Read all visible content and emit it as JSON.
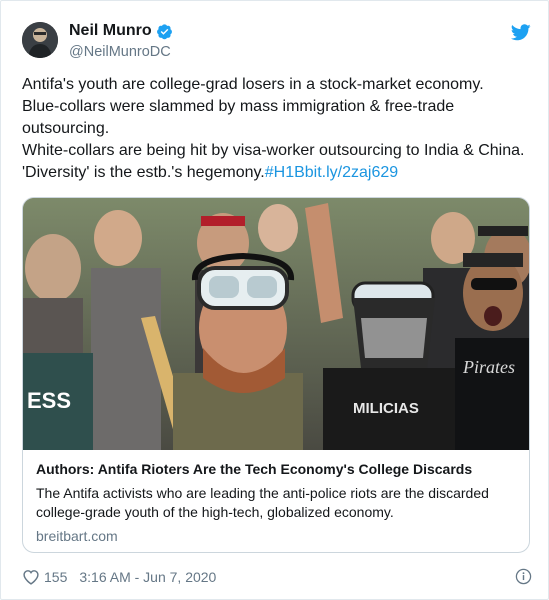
{
  "author": {
    "display_name": "Neil Munro",
    "handle": "@NeilMunroDC",
    "verified_icon": "verified-badge-icon",
    "avatar_icon": "profile-avatar"
  },
  "platform_icon": "twitter-bird-icon",
  "tweet": {
    "lines": [
      "Antifa's youth are college-grad losers in a stock-market economy.",
      "Blue-collars were slammed by mass immigration & free-trade",
      "outsourcing.",
      "White-collars are being hit by visa-worker outsourcing to India & China.",
      "'Diversity' is the estb.'s hegemony."
    ],
    "hashtag": "#H1B",
    "link": "bit.ly/2zaj629"
  },
  "card": {
    "title": "Authors: Antifa Rioters Are the Tech Economy's College Discards",
    "description": "The Antifa activists who are leading the anti-police riots are the discarded college-grade youth of the high-tech, globalized economy.",
    "domain": "breitbart.com",
    "image_text": {
      "shirt_left": "ESS",
      "shirt_center": "MILICIAS",
      "shirt_right": "Pirates"
    }
  },
  "footer": {
    "likes": "155",
    "timestamp": "3:16 AM - Jun 7, 2020"
  },
  "colors": {
    "accent": "#1b95e0",
    "muted": "#657786",
    "border": "#ccd6dd",
    "like": "#657786"
  }
}
